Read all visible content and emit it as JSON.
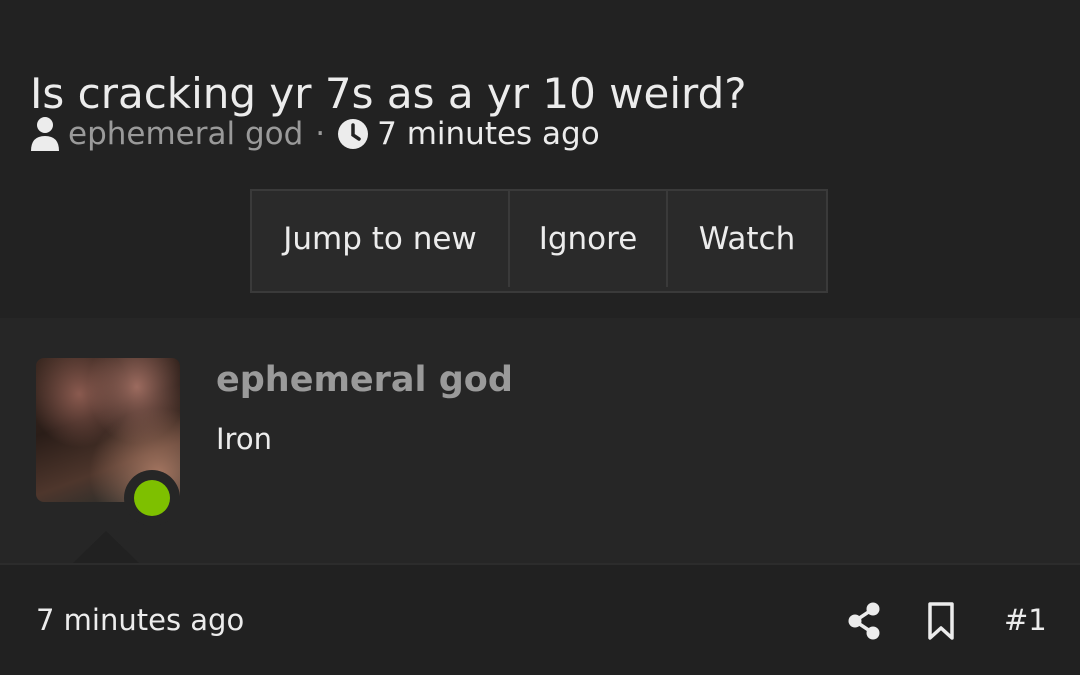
{
  "thread": {
    "title": "Is cracking yr 7s as a yr 10 weird?",
    "author": "ephemeral god",
    "separator": "·",
    "time": "7 minutes ago",
    "author_icon": "user-icon",
    "time_icon": "clock-icon"
  },
  "actions": {
    "jump_label": "Jump to new",
    "ignore_label": "Ignore",
    "watch_label": "Watch"
  },
  "post": {
    "author": "ephemeral god",
    "body": "Iron",
    "online_status_color": "#7ec000",
    "footer": {
      "time": "7 minutes ago",
      "share_icon": "share-icon",
      "bookmark_icon": "bookmark-icon",
      "number": "#1"
    }
  },
  "colors": {
    "background": "#222222",
    "post_background": "#262626",
    "muted_text": "#9a9a9a",
    "online": "#7ec000"
  }
}
